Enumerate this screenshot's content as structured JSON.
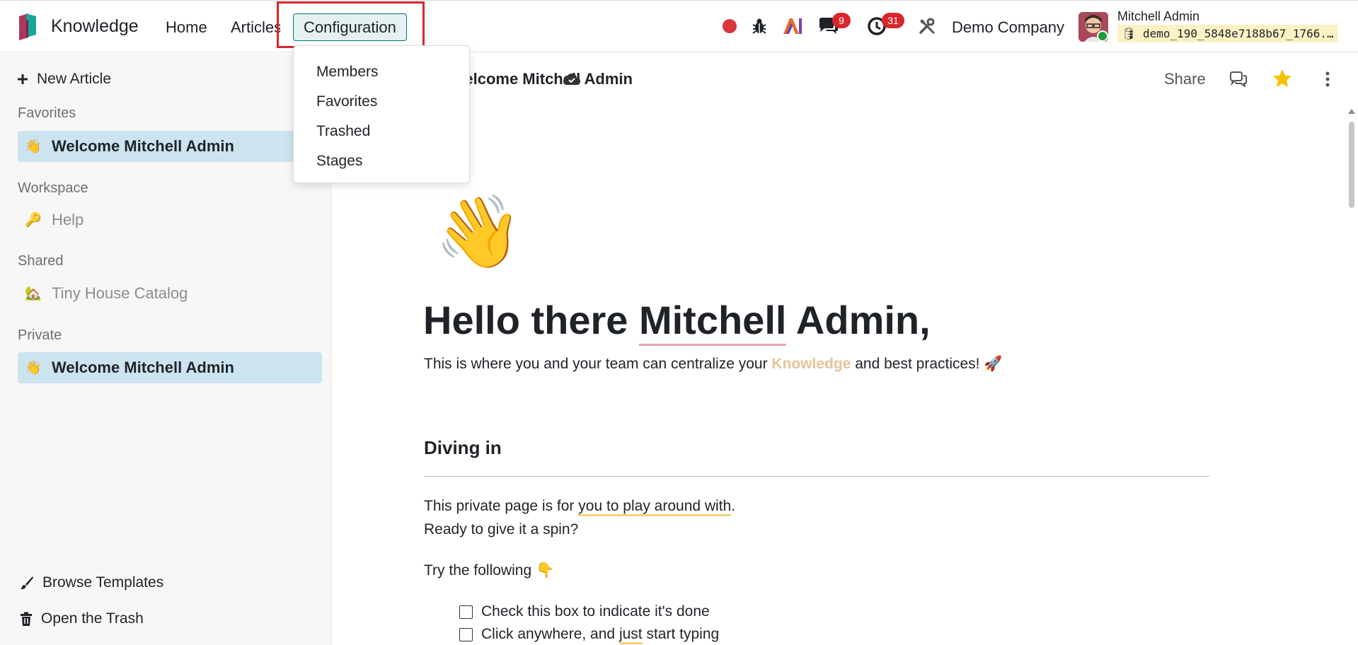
{
  "navbar": {
    "app_name": "Knowledge",
    "menu": {
      "home": "Home",
      "articles": "Articles",
      "configuration": "Configuration"
    },
    "messages_count": "9",
    "activities_count": "31",
    "company": "Demo Company",
    "user": {
      "name": "Mitchell Admin",
      "database": "demo_190_5848e7188b67_1766..."
    }
  },
  "config_menu": {
    "items": [
      "Members",
      "Favorites",
      "Trashed",
      "Stages"
    ]
  },
  "sidebar": {
    "new_article": "New Article",
    "favorites_label": "Favorites",
    "favorites_item": {
      "emoji": "👋",
      "label": "Welcome Mitchell Admin"
    },
    "workspace_label": "Workspace",
    "workspace_item": {
      "emoji": "🔑",
      "label": "Help"
    },
    "shared_label": "Shared",
    "shared_item": {
      "emoji": "🏡",
      "label": "Tiny House Catalog"
    },
    "private_label": "Private",
    "private_item": {
      "emoji": "👋",
      "label": "Welcome Mitchell Admin"
    },
    "browse_templates": "Browse Templates",
    "open_trash": "Open the Trash"
  },
  "article": {
    "header_title": "Welcome Mitchell Admin",
    "share": "Share",
    "icon": "👋",
    "hello_prefix": "Hello there ",
    "hello_name": "Mitchell",
    "hello_suffix": " Admin,",
    "intro_before": "This is where you and your team can centralize your ",
    "intro_keyword": "Knowledge",
    "intro_after": " and best practices! 🚀",
    "section_heading": "Diving in",
    "p1_before": "This private page is for ",
    "p1_highlight": "you to play around with",
    "p1_after": ".",
    "p2": "Ready to give it a spin?",
    "p3": "Try the following 👇",
    "check1": "Check this box to indicate it's done",
    "check2_before": "Click anywhere, and ",
    "check2_highlight": "just",
    "check2_after": " start typing"
  },
  "colors": {
    "accent": "#0f6f7a",
    "badge": "#d8262d",
    "active_item": "#cce4f0",
    "star": "#f3c300"
  }
}
